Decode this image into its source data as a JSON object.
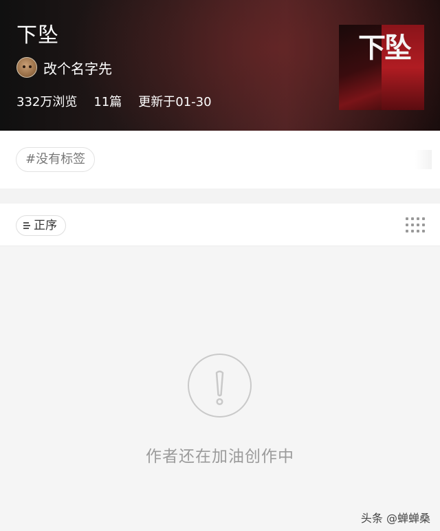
{
  "header": {
    "title": "下坠",
    "author_name": "改个名字先",
    "stats": {
      "views": "332万浏览",
      "count": "11篇",
      "updated": "更新于01-30"
    },
    "cover": {
      "text": "下坠",
      "subtitle": ""
    }
  },
  "tags": {
    "chip_label": "#没有标签"
  },
  "sort": {
    "label": "正序",
    "sort_icon": "sort-lines-icon",
    "view_icon": "grid-dots-icon"
  },
  "empty_state": {
    "icon": "exclamation-circle-icon",
    "message": "作者还在加油创作中"
  },
  "watermark": "头条 @蝉蝉桑",
  "colors": {
    "header_dark": "#101010",
    "header_red": "#4a2324",
    "empty_text": "#9b9b9b"
  }
}
